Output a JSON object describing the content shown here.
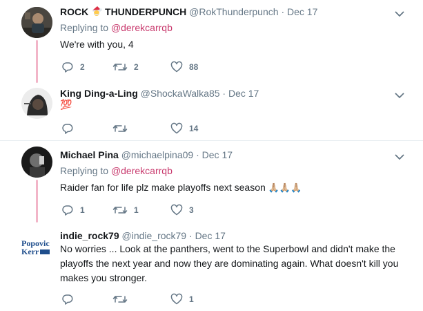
{
  "tweets": [
    {
      "name": "ROCK",
      "name_emoji": "santa-face",
      "name_suffix": "THUNDERPUNCH",
      "handle": "@RokThunderpunch",
      "date": "Dec 17",
      "replying_prefix": "Replying to",
      "replying_to": "@derekcarrqb",
      "text": "We're with you, 4",
      "replies": "2",
      "retweets": "2",
      "likes": "88"
    },
    {
      "name": "King Ding-a-Ling",
      "handle": "@ShockaWalka85",
      "date": "Dec 17",
      "text": "💯",
      "replies": "",
      "retweets": "",
      "likes": "14"
    },
    {
      "name": "Michael Pina",
      "handle": "@michaelpina09",
      "date": "Dec 17",
      "replying_prefix": "Replying to",
      "replying_to": "@derekcarrqb",
      "text": "Raider fan for life plz make playoffs next season",
      "text_emoji": "🙏🏼🙏🏼🙏🏼",
      "replies": "1",
      "retweets": "1",
      "likes": "3"
    },
    {
      "name": "indie_rock79",
      "handle": "@indie_rock79",
      "date": "Dec 17",
      "text": "No worries ... Look at the panthers, went to the Superbowl and didn't make the playoffs the next year and now they are dominating again. What doesn't kill you makes you stronger.",
      "avatar_text_line1": "Popovic",
      "avatar_text_line2": "Kerr",
      "replies": "",
      "retweets": "",
      "likes": "1"
    }
  ],
  "separator": "·",
  "colors": {
    "mention": "#c8396d",
    "thread_line": "#f2b5c8",
    "muted": "#657786",
    "text": "#14171a"
  },
  "icons": {
    "reply": "reply-icon",
    "retweet": "retweet-icon",
    "like": "heart-icon",
    "more": "chevron-down-icon"
  }
}
